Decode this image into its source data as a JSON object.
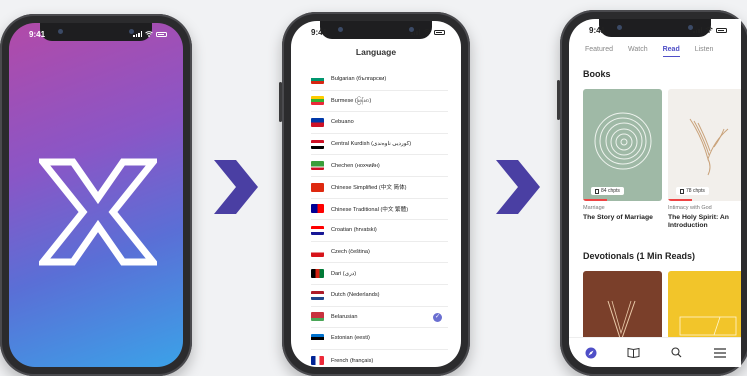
{
  "status_time": "9:41",
  "colors": {
    "accent": "#4f4fc7",
    "arrow": "#4a3fa3",
    "check": "#6a6fd1"
  },
  "language_screen": {
    "title": "Language",
    "languages": [
      {
        "name": "Bulgarian (български)",
        "flag": "bulgaria-flag"
      },
      {
        "name": "Burmese (မြန်မာ)",
        "flag": "myanmar-flag"
      },
      {
        "name": "Cebuano",
        "flag": "philippines-flag"
      },
      {
        "name": "Central Kurdish (کوردیی ناوەندی)",
        "flag": "iraq-flag"
      },
      {
        "name": "Chechen (нохчийн)",
        "flag": "chechnya-flag"
      },
      {
        "name": "Chinese Simplified (中文 简体)",
        "flag": "china-flag"
      },
      {
        "name": "Chinese Traditional (中文 繁體)",
        "flag": "taiwan-flag"
      },
      {
        "name": "Croatian (hrvatski)",
        "flag": "croatia-flag"
      },
      {
        "name": "Czech (čeština)",
        "flag": "czech-flag"
      },
      {
        "name": "Dari (دری)",
        "flag": "afghanistan-flag"
      },
      {
        "name": "Dutch (Nederlands)",
        "flag": "netherlands-flag"
      },
      {
        "name": "Belarusian",
        "flag": "belarus-flag",
        "selected": true
      },
      {
        "name": "Estonian (eesti)",
        "flag": "estonia-flag"
      },
      {
        "name": "French (français)",
        "flag": "france-flag"
      }
    ]
  },
  "read_screen": {
    "tabs": [
      {
        "label": "Featured",
        "active": false
      },
      {
        "label": "Watch",
        "active": false
      },
      {
        "label": "Read",
        "active": true
      },
      {
        "label": "Listen",
        "active": false
      }
    ],
    "books_heading": "Books",
    "books": [
      {
        "chapters": "84 chpts",
        "category": "Marriage",
        "title": "The Story of Marriage"
      },
      {
        "chapters": "78 chpts",
        "category": "Intimacy with God",
        "title": "The Holy Spirit: An Introduction"
      }
    ],
    "devotionals_heading": "Devotionals (1 Min Reads)",
    "bottom_nav": [
      "compass-icon",
      "book-icon",
      "search-icon",
      "menu-icon"
    ]
  }
}
